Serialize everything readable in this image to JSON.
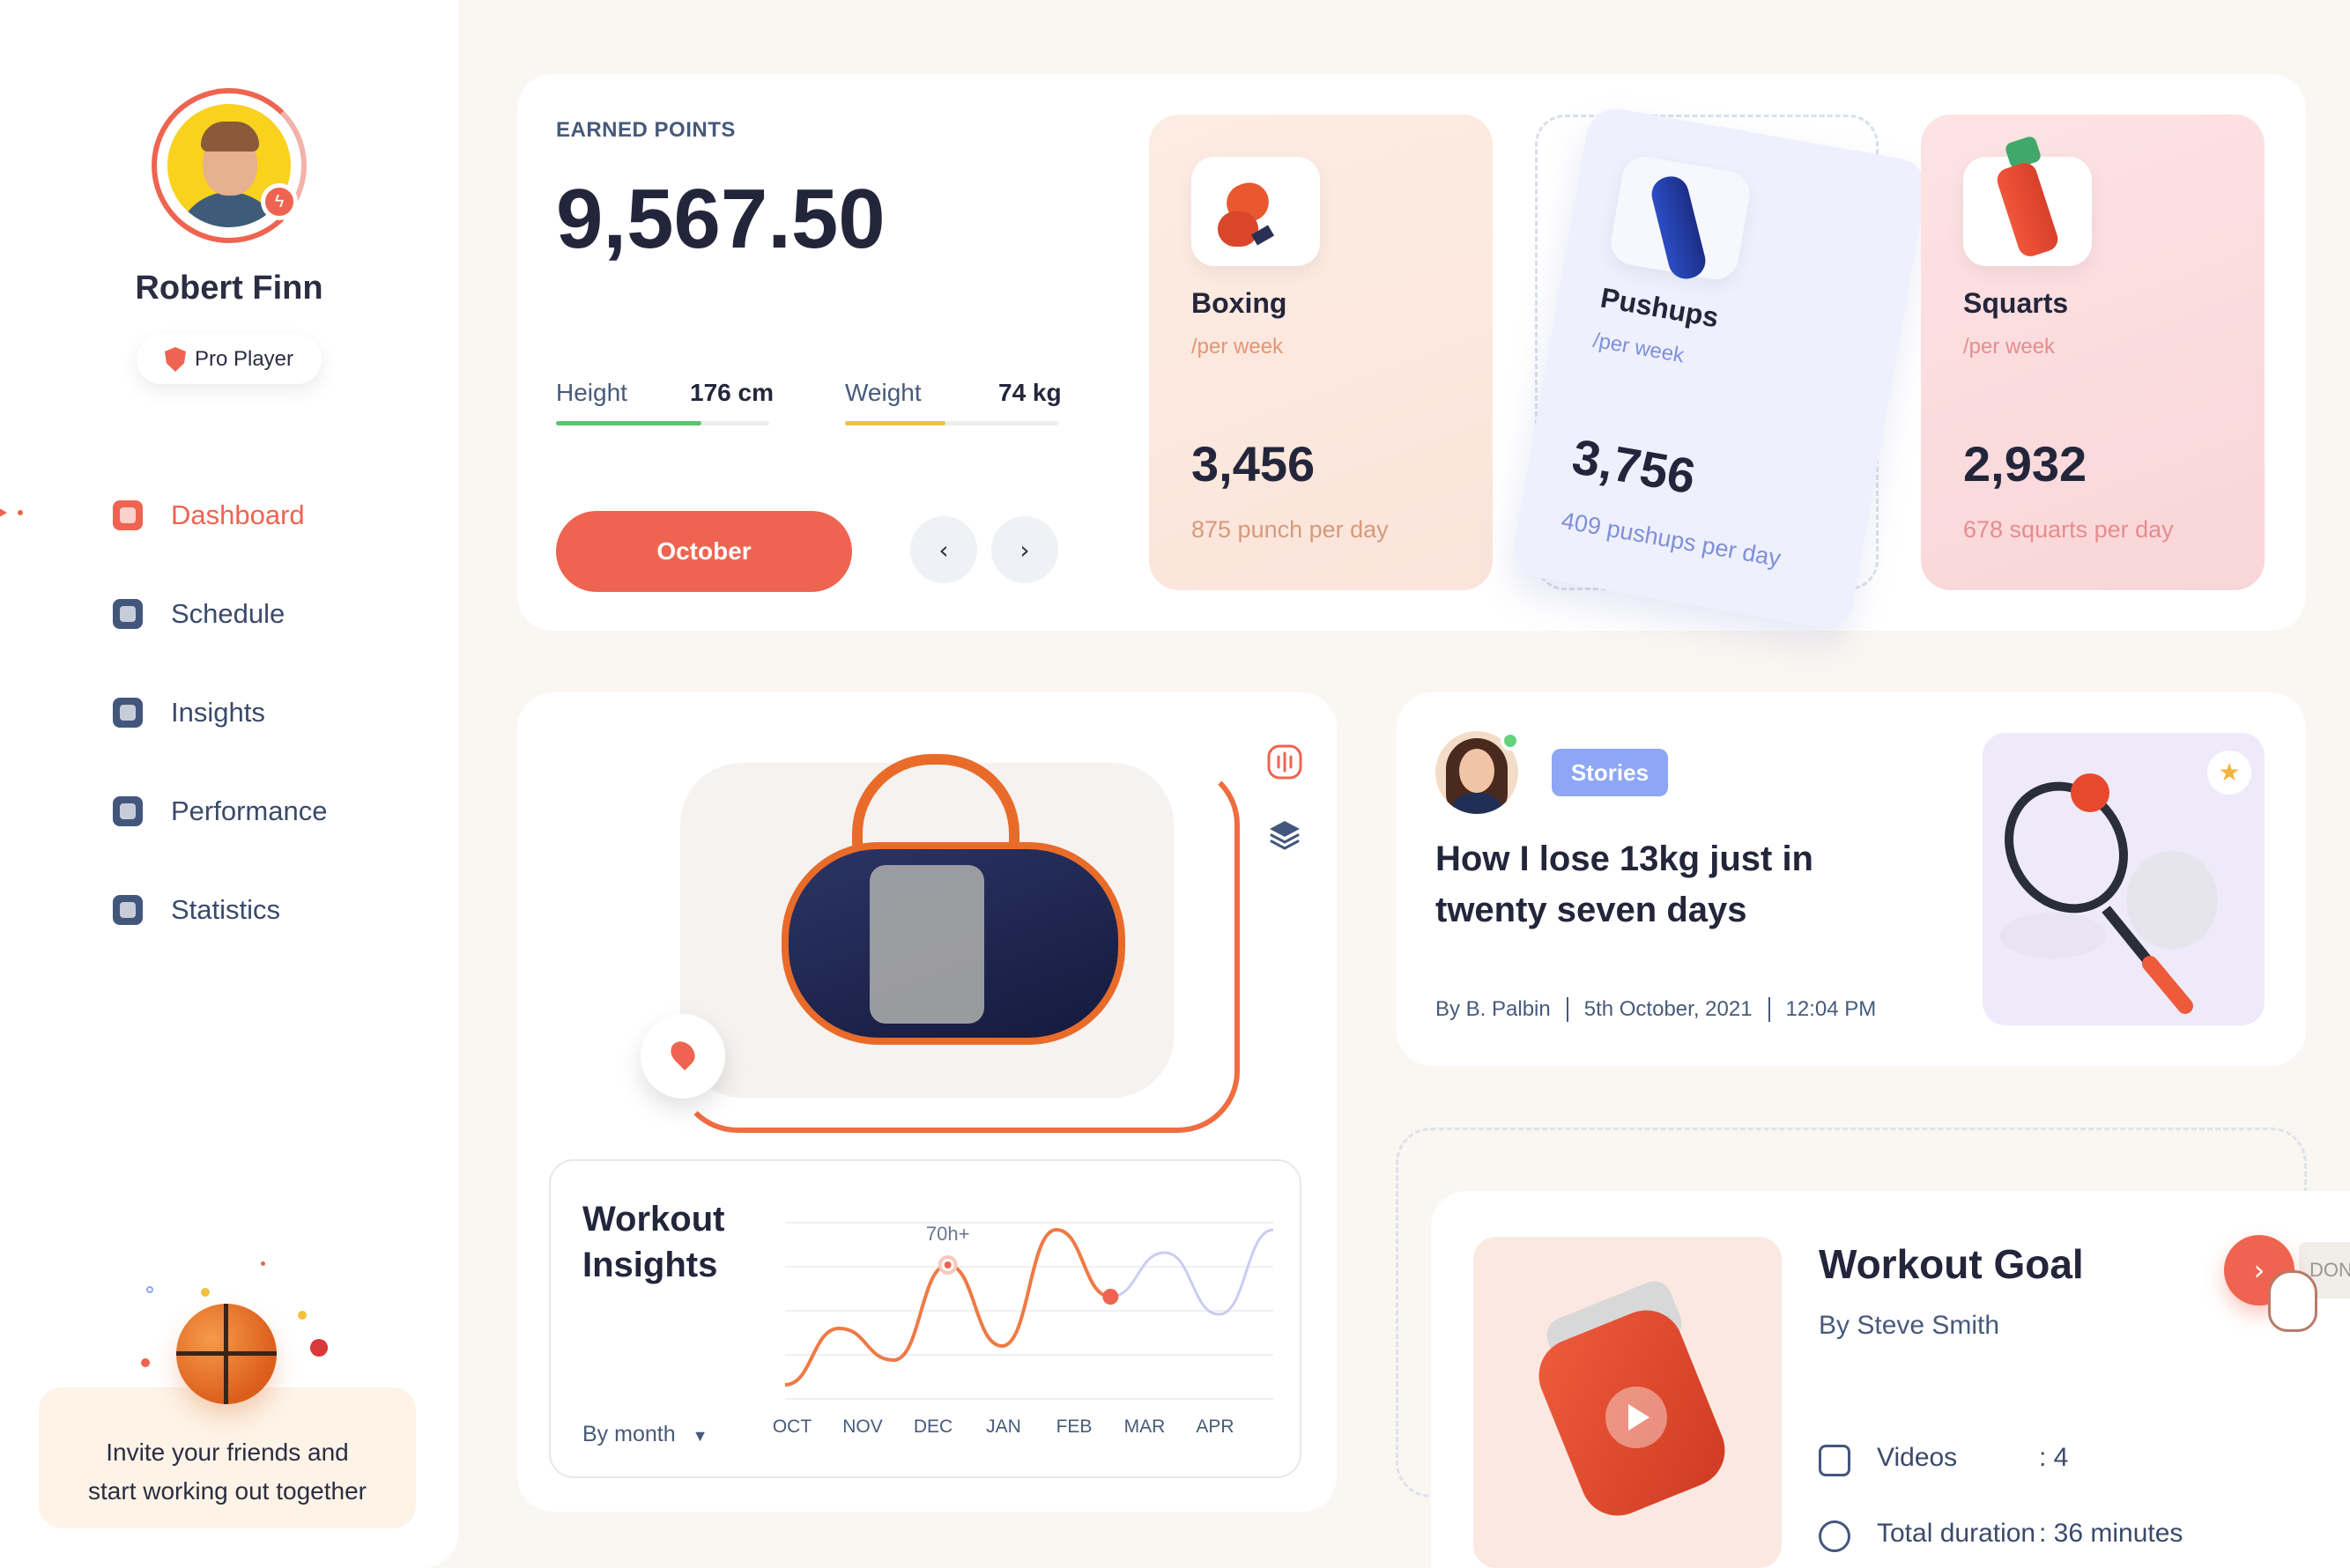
{
  "user": {
    "name": "Robert Finn",
    "badge": "Pro Player"
  },
  "nav": {
    "items": [
      {
        "label": "Dashboard",
        "icon": "dashboard-icon",
        "active": true
      },
      {
        "label": "Schedule",
        "icon": "calendar-icon",
        "active": false
      },
      {
        "label": "Insights",
        "icon": "insights-icon",
        "active": false
      },
      {
        "label": "Performance",
        "icon": "performance-icon",
        "active": false
      },
      {
        "label": "Statistics",
        "icon": "statistics-icon",
        "active": false
      }
    ]
  },
  "invite": {
    "line1": "Invite your friends and",
    "line2": "start working out together"
  },
  "points": {
    "label": "EARNED POINTS",
    "value": "9,567.50",
    "height_label": "Height",
    "height_value": "176 cm",
    "height_fill": 0.68,
    "weight_label": "Weight",
    "weight_value": "74 kg",
    "weight_fill": 0.47,
    "month": "October",
    "prev_icon": "chevron-left-icon",
    "next_icon": "chevron-right-icon"
  },
  "activities": [
    {
      "name": "Boxing",
      "per": "/per week",
      "count": "3,456",
      "daily": "875 punch per day",
      "icon": "boxing-glove-icon"
    },
    {
      "name": "Pushups",
      "per": "/per week",
      "count": "3,756",
      "daily": "409 pushups per day",
      "icon": "yoga-mat-icon"
    },
    {
      "name": "Squarts",
      "per": "/per week",
      "count": "2,932",
      "daily": "678 squarts per day",
      "icon": "water-bottle-icon"
    }
  ],
  "workout_insights": {
    "title_line1": "Workout",
    "title_line2": "Insights",
    "filter": "By month"
  },
  "chart_data": {
    "type": "line",
    "title": "Workout Insights",
    "categories": [
      "OCT",
      "NOV",
      "DEC",
      "JAN",
      "FEB",
      "MAR",
      "APR"
    ],
    "annotation": "70h+",
    "grid": true,
    "series": [
      {
        "values": [
          8,
          40,
          22,
          76,
          30,
          96,
          58,
          83,
          48,
          96
        ]
      }
    ]
  },
  "story": {
    "badge": "Stories",
    "title": "How I lose 13kg just in twenty seven days",
    "author": "By B. Palbin",
    "date": "5th October, 2021",
    "time": "12:04 PM"
  },
  "goal": {
    "title": "Workout Goal",
    "author": "By Steve Smith",
    "videos_label": "Videos",
    "videos_value": ": 4",
    "duration_label": "Total duration",
    "duration_value": ": 36 minutes",
    "done_label": "DON"
  },
  "colors": {
    "accent": "#ee6450",
    "height_bar": "#5cc26f",
    "weight_bar": "#f3c140",
    "line": "#ef7a45"
  }
}
